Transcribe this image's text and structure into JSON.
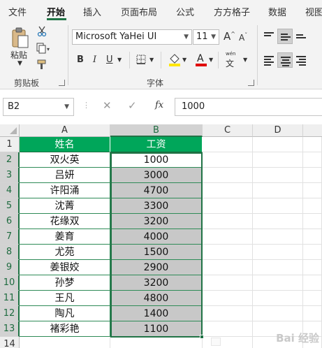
{
  "ribbon_tabs": [
    "文件",
    "开始",
    "插入",
    "页面布局",
    "公式",
    "方方格子",
    "数据",
    "视图"
  ],
  "active_tab": "开始",
  "clipboard": {
    "paste_label": "粘贴",
    "group_label": "剪贴板"
  },
  "font": {
    "name": "Microsoft YaHei UI",
    "size": "11",
    "group_label": "字体",
    "bold": "B",
    "italic": "I",
    "underline": "U",
    "wen_label": "wén",
    "grow": "A",
    "shrink": "A"
  },
  "formula_bar": {
    "name_box": "B2",
    "formula": "1000",
    "fx": "fx"
  },
  "columns": [
    "A",
    "B",
    "C",
    "D"
  ],
  "rows": [
    "1",
    "2",
    "3",
    "4",
    "5",
    "6",
    "7",
    "8",
    "9",
    "10",
    "11",
    "12",
    "13",
    "14"
  ],
  "table": {
    "headers": [
      "姓名",
      "工资"
    ],
    "rows": [
      [
        "双火英",
        "1000"
      ],
      [
        "吕妍",
        "3000"
      ],
      [
        "许阳涌",
        "4700"
      ],
      [
        "沈菁",
        "3300"
      ],
      [
        "花缘双",
        "3200"
      ],
      [
        "姜育",
        "4000"
      ],
      [
        "尤苑",
        "1500"
      ],
      [
        "姜银姣",
        "2900"
      ],
      [
        "孙梦",
        "3200"
      ],
      [
        "王凡",
        "4800"
      ],
      [
        "陶凡",
        "1400"
      ],
      [
        "褚彩艳",
        "1100"
      ]
    ]
  },
  "selection": {
    "active_cell": "B2",
    "range": "B2:B13"
  },
  "colors": {
    "accent": "#217346",
    "header_fill": "#00a65a",
    "selection_fill": "#c8c8c8"
  },
  "watermark": "Bai 经验"
}
